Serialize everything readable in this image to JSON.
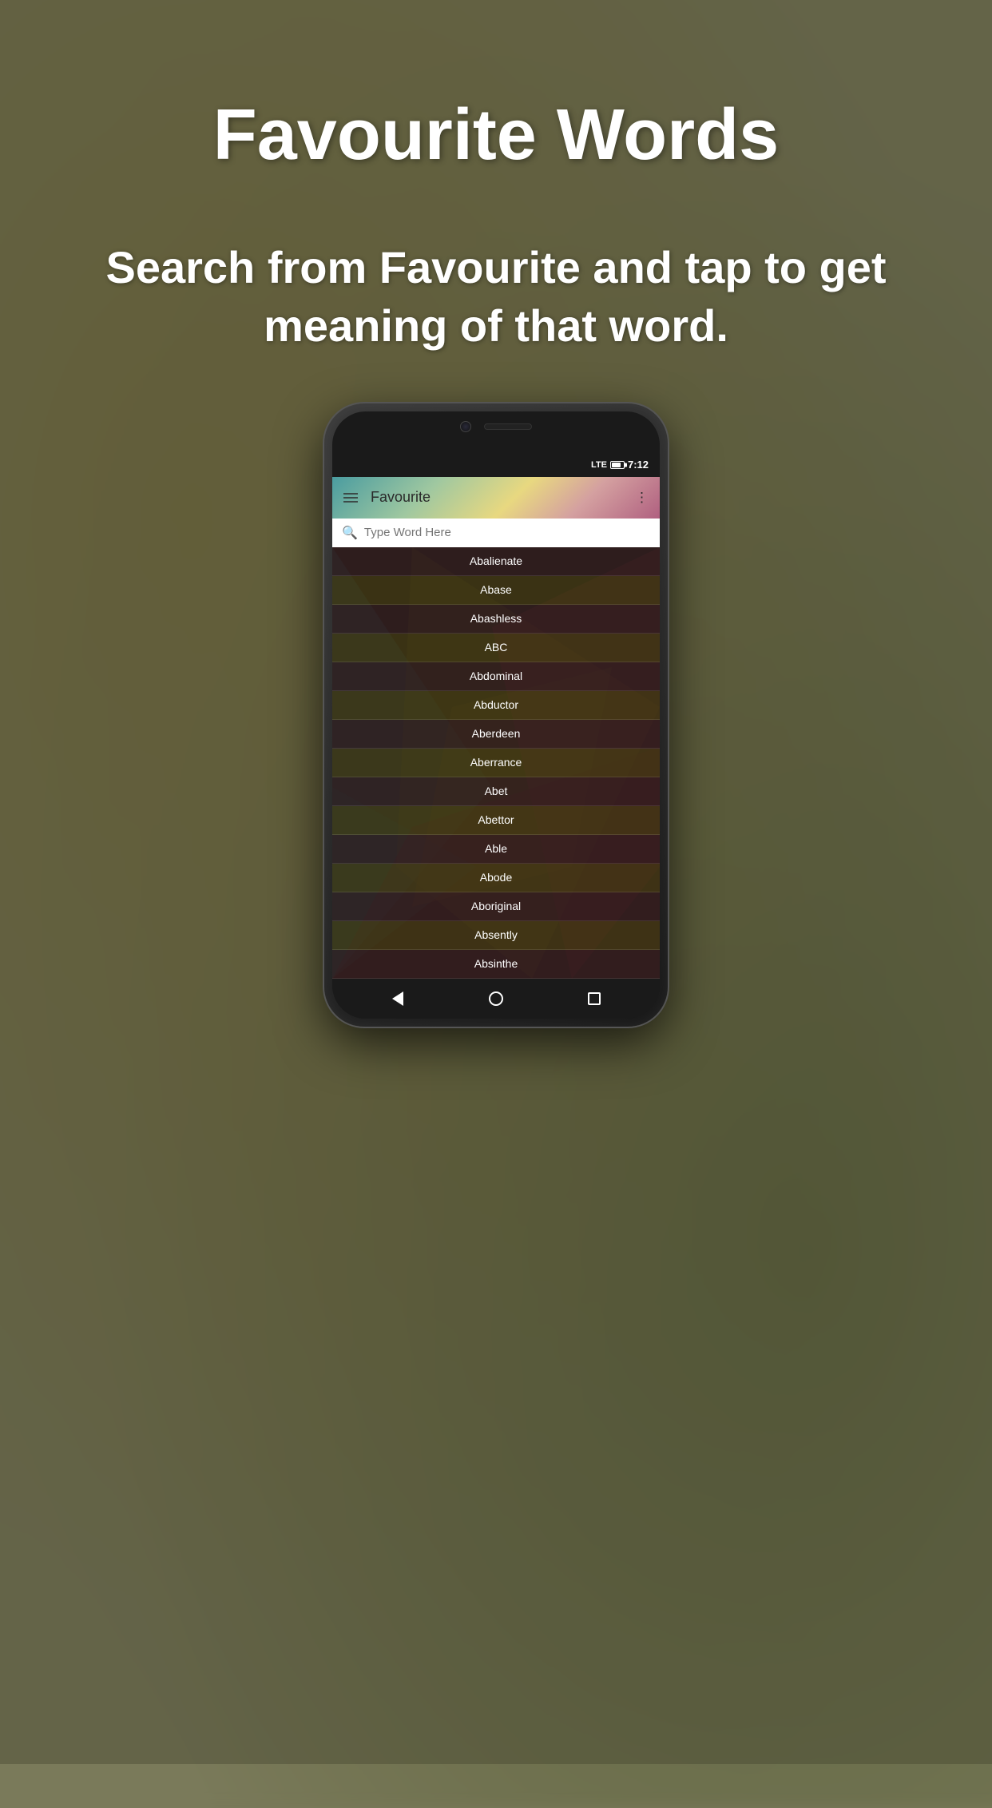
{
  "page": {
    "title": "Favourite Words",
    "subtitle": "Search from Favourite and tap to get meaning of that word.",
    "background_colors": [
      "#7a7a5a",
      "#6a6a4a"
    ]
  },
  "phone": {
    "status_bar": {
      "lte": "LTE",
      "time": "7:12"
    },
    "toolbar": {
      "menu_label": "menu",
      "title": "Favourite",
      "share_label": "share"
    },
    "search": {
      "placeholder": "Type Word Here"
    },
    "word_list": [
      "Abalienate",
      "Abase",
      "Abashless",
      "ABC",
      "Abdominal",
      "Abductor",
      "Aberdeen",
      "Aberrance",
      "Abet",
      "Abettor",
      "Able",
      "Abode",
      "Aboriginal",
      "Absently",
      "Absinthe"
    ],
    "nav": {
      "back": "back",
      "home": "home",
      "recent": "recent"
    }
  }
}
